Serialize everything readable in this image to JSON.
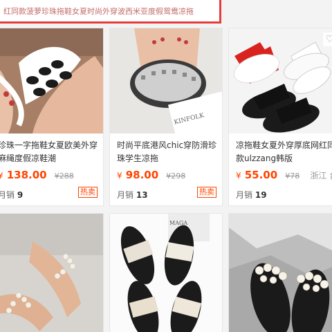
{
  "search": {
    "text": "红同款菠萝珍珠拖鞋女夏时尚外穿波西米亚度假鸳鸯凉拖"
  },
  "products": [
    {
      "title": "珍珠一字拖鞋女夏欧美外穿麻绳度假凉鞋潮",
      "yen": "¥",
      "price": "138.00",
      "old_price": "¥288",
      "location": "",
      "sales_label": "月销",
      "sales_count": "9",
      "hot_label": "热卖"
    },
    {
      "title": "时尚平底港风chic穿防滑珍珠学生凉拖",
      "yen": "¥",
      "price": "98.00",
      "old_price": "¥298",
      "location": "",
      "sales_label": "月销",
      "sales_count": "13",
      "hot_label": "热卖",
      "photo_text": "KINFOLK"
    },
    {
      "title": "凉拖鞋女夏外穿厚底网红同款ulzzang韩版",
      "yen": "¥",
      "price": "55.00",
      "old_price": "¥78",
      "location": "浙江 台州",
      "sales_label": "月销",
      "sales_count": "19",
      "hot_label": ""
    },
    {
      "title": "",
      "price": ""
    },
    {
      "title": "",
      "price": "",
      "photo_text": "MAGA"
    },
    {
      "title": "",
      "price": ""
    }
  ],
  "icons": {
    "favorite": "heart-icon"
  }
}
